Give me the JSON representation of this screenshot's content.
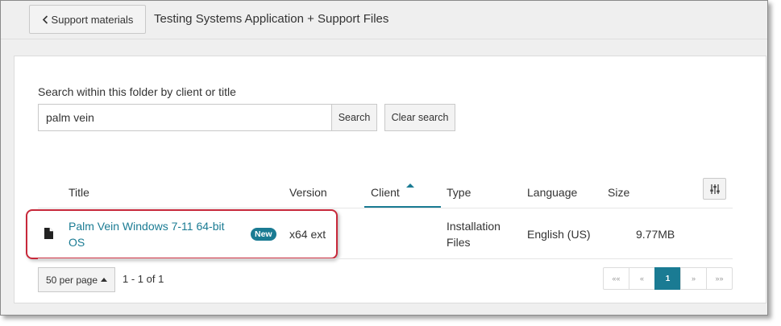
{
  "header": {
    "back_label": "Support materials",
    "folder_title": "Testing Systems Application + Support Files"
  },
  "search": {
    "label": "Search within this folder by client or title",
    "value": "palm vein",
    "search_button": "Search",
    "clear_button": "Clear search"
  },
  "table": {
    "columns": {
      "title": "Title",
      "version": "Version",
      "client": "Client",
      "type": "Type",
      "language": "Language",
      "size": "Size"
    },
    "sort": {
      "column": "Client",
      "direction": "ascending"
    },
    "rows": [
      {
        "title": "Palm Vein Windows 7-11 64-bit OS",
        "badge": "New",
        "version": "x64 ext",
        "client": "",
        "type": "Installation Files",
        "language": "English (US)",
        "size": "9.77MB"
      }
    ]
  },
  "footer": {
    "per_page": "50 per page",
    "range": "1 - 1 of 1",
    "pager": {
      "first": "««",
      "prev": "«",
      "current": "1",
      "next": "»",
      "last": "»»"
    }
  },
  "colors": {
    "accent": "#1a7b93",
    "highlight_border": "#c7283a"
  }
}
